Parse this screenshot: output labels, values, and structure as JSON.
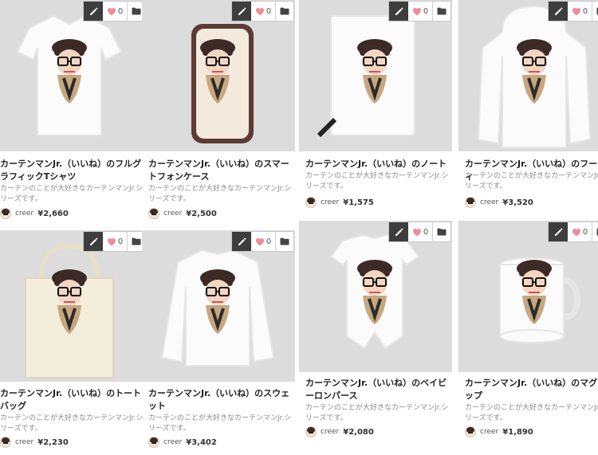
{
  "products": [
    {
      "title": "カーテンマンJr.（いいね）のフルグラフィックTシャツ",
      "description": "カーテンのことが大好きなカーテンマンJr.シリーズです。",
      "likes": "0",
      "seller": "creer",
      "price": "¥2,660",
      "item_icon": "t-shirt-product-image"
    },
    {
      "title": "カーテンマンJr.（いいね）のスマートフォンケース",
      "description": "カーテンのことが大好きなカーテンマンJr.シリーズです。",
      "likes": "0",
      "seller": "creer",
      "price": "¥2,500",
      "item_icon": "phone-case-product-image"
    },
    {
      "title": "カーテンマンJr.（いいね）のノート",
      "description": "カーテンのことが大好きなカーテンマンJr.シリーズです。",
      "likes": "0",
      "seller": "creer",
      "price": "¥1,575",
      "item_icon": "notebook-product-image"
    },
    {
      "title": "カーテンマンJr.（いいね）のフーディ",
      "description": "カーテンのことが大好きなカーテンマンJr.シリーズです。",
      "likes": "0",
      "seller": "creer",
      "price": "¥3,520",
      "item_icon": "hoodie-product-image"
    },
    {
      "title": "カーテンマンJr.（いいね）のトートバッグ",
      "description": "カーテンのことが大好きなカーテンマンJr.シリーズです。",
      "likes": "0",
      "seller": "creer",
      "price": "¥2,230",
      "item_icon": "tote-bag-product-image"
    },
    {
      "title": "カーテンマンJr.（いいね）のスウェット",
      "description": "カーテンのことが大好きなカーテンマンJr.シリーズです。",
      "likes": "0",
      "seller": "creer",
      "price": "¥3,402",
      "item_icon": "sweatshirt-product-image"
    },
    {
      "title": "カーテンマンJr.（いいね）のベイビーロンパース",
      "description": "カーテンのことが大好きなカーテンマンJr.シリーズです。",
      "likes": "0",
      "seller": "creer",
      "price": "¥2,080",
      "item_icon": "baby-rompers-product-image"
    },
    {
      "title": "カーテンマンJr.（いいね）のマグカップ",
      "description": "カーテンのことが大好きなカーテンマンJr.シリーズです。",
      "likes": "0",
      "seller": "creer",
      "price": "¥1,890",
      "item_icon": "mug-product-image"
    }
  ],
  "colors": {
    "thumb_bg": "#dcdcdc",
    "edit_bg": "#3d3d3d",
    "heart": "#f08c96",
    "character_hat": "#3b2a25",
    "character_coat": "#c6a77f"
  },
  "icons": {
    "edit": "pencil-icon",
    "like": "heart-icon",
    "folder": "folder-icon"
  }
}
